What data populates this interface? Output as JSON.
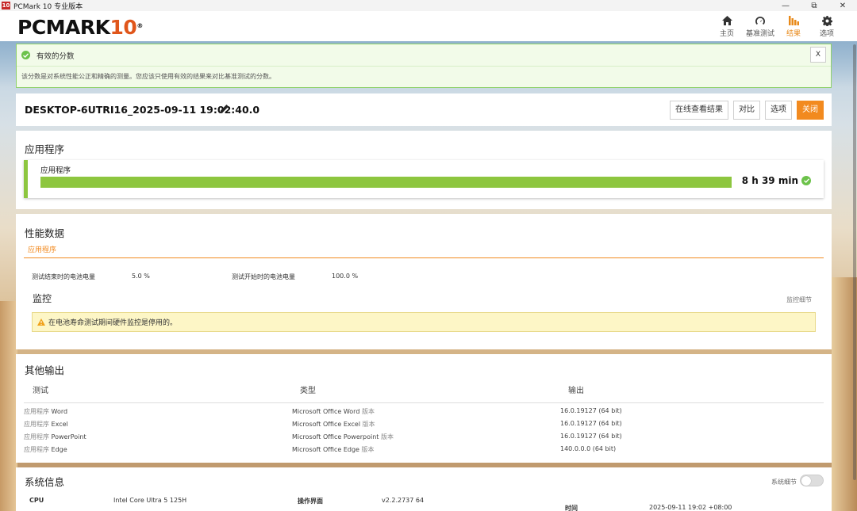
{
  "window": {
    "title": "PCMark 10 专业版本",
    "app_icon_text": "10",
    "controls": [
      "—",
      "⧉",
      "✕"
    ]
  },
  "header": {
    "logo_main": "PCMARK",
    "logo_num": "10",
    "logo_reg": "®",
    "nav": [
      {
        "label": "主页",
        "icon": "home-icon"
      },
      {
        "label": "基准测试",
        "icon": "gauge-icon"
      },
      {
        "label": "结果",
        "icon": "bar-chart-icon",
        "active": true
      },
      {
        "label": "选项",
        "icon": "gear-icon"
      }
    ]
  },
  "valid_banner": {
    "title": "有效的分数",
    "body": "该分数是对系统性能公正和精确的测量。您应该只使用有效的结果来对比基准测试的分数。",
    "close_label": "X"
  },
  "result": {
    "name": "DESKTOP-6UTRI16_2025-09-11 19:02:40.0",
    "buttons": {
      "view_online": "在线查看结果",
      "compare": "对比",
      "options": "选项",
      "close": "关闭"
    }
  },
  "applications": {
    "section_title": "应用程序",
    "item_label": "应用程序",
    "score": "8 h 39 min",
    "bar_fill": 1.0,
    "accent": "#8dc63f"
  },
  "performance": {
    "section_title": "性能数据",
    "tab": "应用程序",
    "battery_end_label": "测试结束时的电池电量",
    "battery_end_value": "5.0 %",
    "battery_start_label": "测试开始时的电池电量",
    "battery_start_value": "100.0 %",
    "monitor_title": "监控",
    "monitor_link": "监控细节",
    "warning": "在电池寿命测试期间硬件监控是停用的。"
  },
  "other_output": {
    "section_title": "其他输出",
    "columns": [
      "测试",
      "类型",
      "输出"
    ],
    "rows": [
      {
        "test_prefix": "应用程序",
        "test": "Word",
        "type": "Microsoft Office Word",
        "type_suffix": "版本",
        "output": "16.0.19127 (64 bit)"
      },
      {
        "test_prefix": "应用程序",
        "test": "Excel",
        "type": "Microsoft Office Excel",
        "type_suffix": "版本",
        "output": "16.0.19127 (64 bit)"
      },
      {
        "test_prefix": "应用程序",
        "test": "PowerPoint",
        "type": "Microsoft Office Powerpoint",
        "type_suffix": "版本",
        "output": "16.0.19127 (64 bit)"
      },
      {
        "test_prefix": "应用程序",
        "test": "Edge",
        "type": "Microsoft Office Edge",
        "type_suffix": "版本",
        "output": "140.0.0.0 (64 bit)"
      }
    ]
  },
  "system_info": {
    "section_title": "系统信息",
    "details_link": "系统细节",
    "cpu_label": "CPU",
    "cpu_value": "Intel Core Ultra 5 125H",
    "ui_label": "操作界面",
    "ui_value": "v2.2.2737 64",
    "time_label": "时间",
    "time_value": "2025-09-11 19:02 +08:00"
  },
  "colors": {
    "accent_orange": "#f28a1f",
    "valid_green": "#6cc24a",
    "bar_green": "#8dc63f"
  }
}
